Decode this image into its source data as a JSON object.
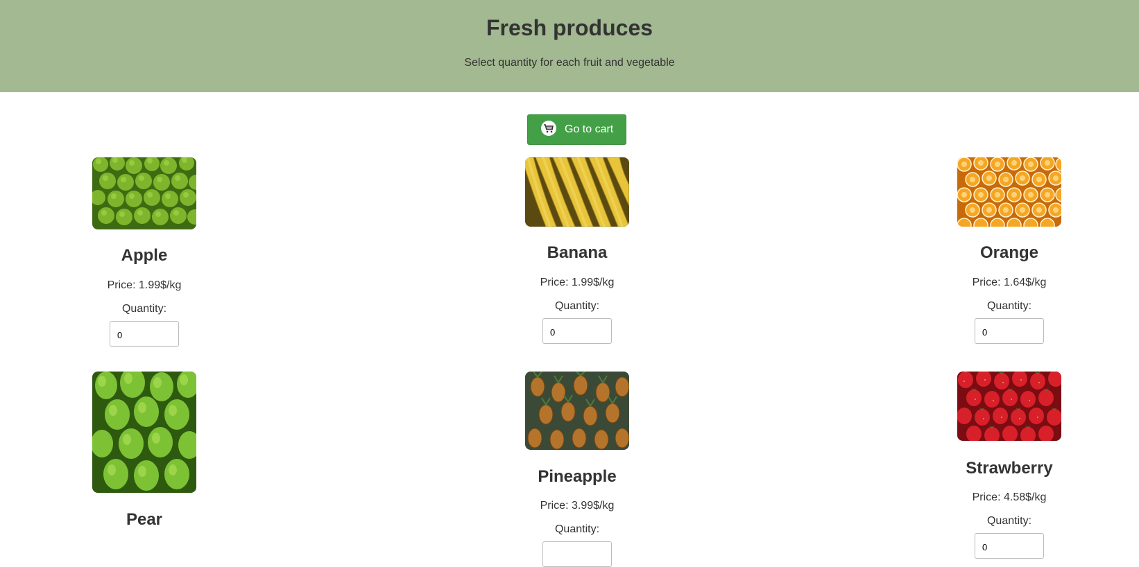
{
  "header": {
    "title": "Fresh produces",
    "subtitle": "Select quantity for each fruit and vegetable"
  },
  "cart_button": {
    "label": "Go to cart",
    "icon": "cart-icon"
  },
  "colors": {
    "header_bg": "#a2b991",
    "button_bg": "#43a047"
  },
  "products": [
    {
      "name": "Apple",
      "price": "Price: 1.99$/kg",
      "quantity_label": "Quantity:",
      "quantity": "0",
      "image": "green-apples-image"
    },
    {
      "name": "Banana",
      "price": "Price: 1.99$/kg",
      "quantity_label": "Quantity:",
      "quantity": "0",
      "image": "bananas-image"
    },
    {
      "name": "Orange",
      "price": "Price: 1.64$/kg",
      "quantity_label": "Quantity:",
      "quantity": "0",
      "image": "orange-slices-image"
    },
    {
      "name": "Pear",
      "price": "",
      "quantity_label": "",
      "quantity": "",
      "image": "green-pears-image"
    },
    {
      "name": "Pineapple",
      "price": "Price: 3.99$/kg",
      "quantity_label": "Quantity:",
      "quantity": "",
      "image": "pineapples-image"
    },
    {
      "name": "Strawberry",
      "price": "Price: 4.58$/kg",
      "quantity_label": "Quantity:",
      "quantity": "0",
      "image": "strawberries-image"
    }
  ]
}
